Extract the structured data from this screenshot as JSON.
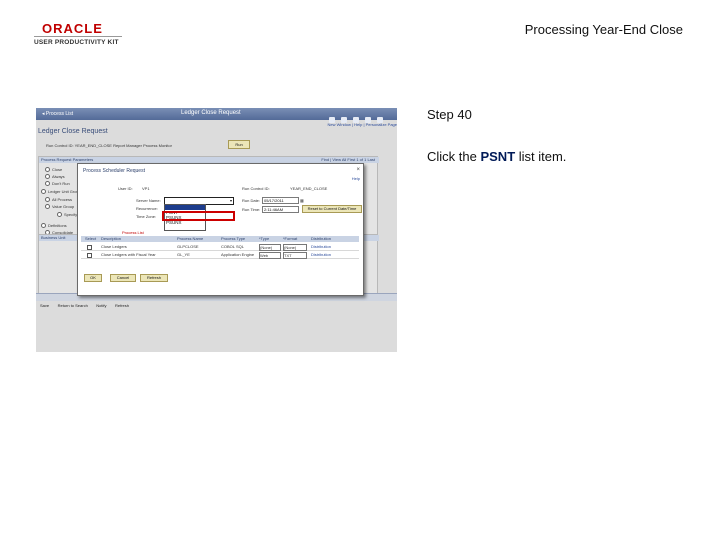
{
  "header": {
    "logo_brand": "ORACLE",
    "logo_sub": "USER PRODUCTIVITY KIT",
    "doc_title": "Processing Year-End Close"
  },
  "instructions": {
    "step": "Step 40",
    "prefix": "Click the ",
    "target": "PSNT",
    "suffix": " list item."
  },
  "screenshot": {
    "topbar_left": "◂ Process List",
    "topbar_center": "Ledger Close Request",
    "links": "New Window | Help | Personalize Page",
    "page_heading": "Ledger Close Request",
    "meta": "Run Control ID:  YEAR_END_CLOSE       Report Manager      Process Monitor",
    "run_label": "Run",
    "panel_title": "Process Request Parameters",
    "panel_right": "Find | View All   First  1 of 1  Last",
    "radios": [
      "Close",
      "Always",
      "Don't Run"
    ],
    "ledger_label": "Ledger Unit Group",
    "ledger_radios": [
      "All Process",
      "Value Group"
    ],
    "specify_label": "Specify",
    "definitions_label": "Definitions",
    "def_radios": [
      "Consolidate",
      "Detail - Select"
    ],
    "business_label": "Business Unit",
    "footer_items": [
      "Save",
      "Return to Search",
      "Notify",
      "Refresh"
    ],
    "modal": {
      "title": "Process Scheduler Request",
      "help": "Help",
      "user_id_label": "User ID:",
      "user_id_value": "VP1",
      "run_ctrl_label": "Run Control ID:",
      "run_ctrl_value": "YEAR_END_CLOSE",
      "server_label": "Server Name:",
      "server_value": "",
      "recurrence_label": "Recurrence:",
      "timezone_label": "Time Zone:",
      "run_date_label": "Run Date:",
      "run_date_value": "05/17/2011",
      "run_time_label": "Run Time:",
      "run_time_value": "2:11:46AM",
      "reset_btn": "Reset to Current Date/Time",
      "dropdown_items": [
        "",
        "PSNT",
        "PSUNX",
        "PSUNX"
      ],
      "process_list_label": "Process List",
      "table_headers": [
        "Select",
        "Description",
        "Process Name",
        "Process Type",
        "*Type",
        "*Format",
        "Distribution"
      ],
      "rows": [
        {
          "desc": "Close Ledgers",
          "name": "GLPCLOSE",
          "type": "COBOL SQL",
          "out": "(None)",
          "fmt": "(None)",
          "dist": "Distribution"
        },
        {
          "desc": "Close Ledgers with Fiscal Year",
          "name": "GL_YE",
          "type": "Application Engine",
          "out": "Web",
          "fmt": "TXT",
          "dist": "Distribution"
        }
      ],
      "ok_btn": "OK",
      "cancel_btn": "Cancel",
      "refresh_btn": "Refresh"
    }
  }
}
